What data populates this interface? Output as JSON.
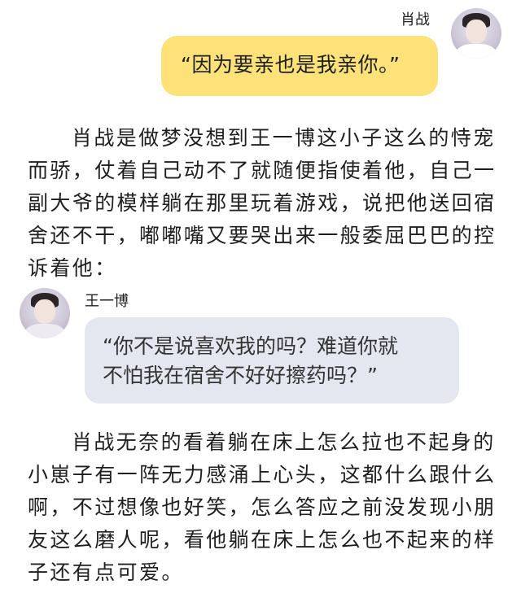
{
  "messages": {
    "right": {
      "name": "肖战",
      "avatar_icon": "person-avatar-icon",
      "text": "“因为要亲也是我亲你。”",
      "bubble_color": "#fde27a"
    },
    "left": {
      "name": "王一博",
      "avatar_icon": "person-avatar-icon",
      "text_line1": "“你不是说喜欢我的吗？难道你就",
      "text_line2": "不怕我在宿舍不好好擦药吗？”",
      "bubble_color": "#e4e7ef"
    }
  },
  "paragraphs": [
    "肖战是做梦没想到王一博这小子这么的恃宠而骄，仗着自己动不了就随便指使着他，自己一副大爷的模样躺在那里玩着游戏，说把他送回宿舍还不干，嘟嘟嘴又要哭出来一般委屈巴巴的控诉着他：",
    "肖战无奈的看着躺在床上怎么拉也不起身的小崽子有一阵无力感涌上心头，这都什么跟什么啊，不过想像也好笑，怎么答应之前没发现小朋友这么磨人呢，看他躺在床上怎么也不起来的样子还有点可爱。"
  ]
}
